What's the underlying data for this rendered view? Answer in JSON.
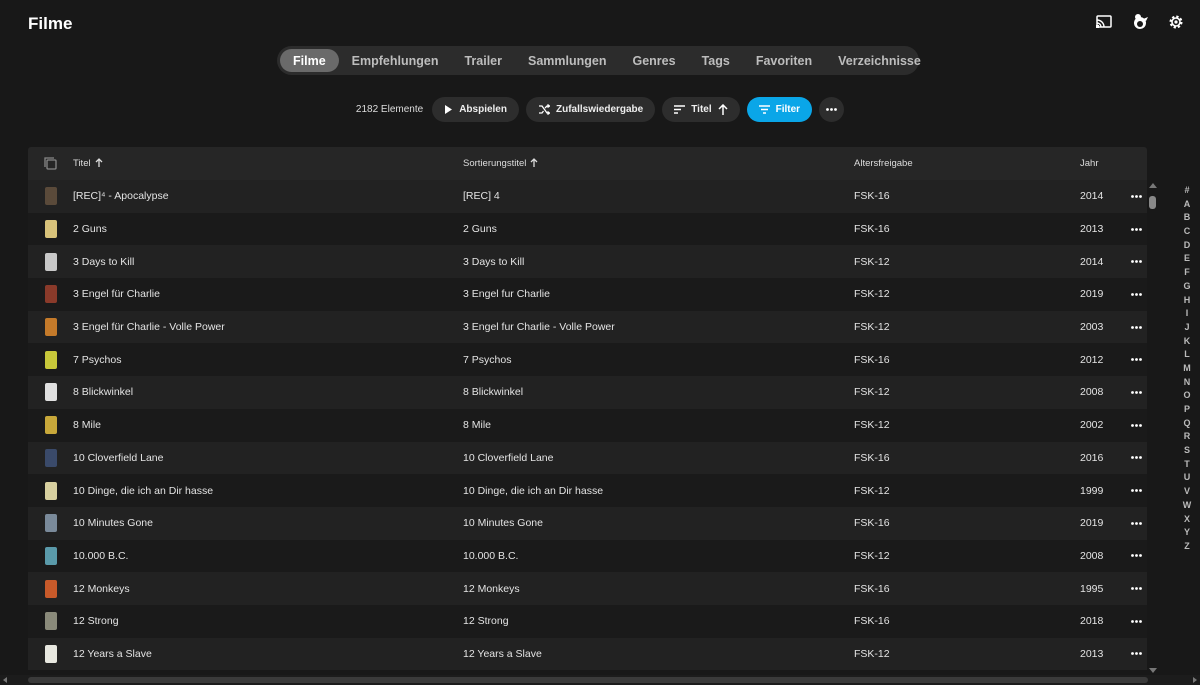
{
  "header": {
    "title": "Filme",
    "icons": [
      "cast-icon",
      "user-avatar-icon",
      "settings-icon"
    ]
  },
  "tabs": [
    {
      "label": "Filme",
      "active": true
    },
    {
      "label": "Empfehlungen"
    },
    {
      "label": "Trailer"
    },
    {
      "label": "Sammlungen"
    },
    {
      "label": "Genres"
    },
    {
      "label": "Tags"
    },
    {
      "label": "Favoriten"
    },
    {
      "label": "Verzeichnisse"
    }
  ],
  "toolbar": {
    "count": "2182 Elemente",
    "play": "Abspielen",
    "shuffle": "Zufallswiedergabe",
    "sort": "Titel",
    "filter": "Filter"
  },
  "columns": {
    "title": "Titel",
    "sort_title": "Sortierungstitel",
    "age": "Altersfreigabe",
    "year": "Jahr"
  },
  "rows": [
    {
      "title": "[REC]⁴ - Apocalypse",
      "sort_title": "[REC] 4",
      "age": "FSK-16",
      "year": "2014",
      "poster": "#5a4a3a"
    },
    {
      "title": "2 Guns",
      "sort_title": "2 Guns",
      "age": "FSK-16",
      "year": "2013",
      "poster": "#d8c27a"
    },
    {
      "title": "3 Days to Kill",
      "sort_title": "3 Days to Kill",
      "age": "FSK-12",
      "year": "2014",
      "poster": "#c8c8c8"
    },
    {
      "title": "3 Engel für Charlie",
      "sort_title": "3 Engel fur Charlie",
      "age": "FSK-12",
      "year": "2019",
      "poster": "#8a3a2a"
    },
    {
      "title": "3 Engel für Charlie - Volle Power",
      "sort_title": "3 Engel fur Charlie - Volle Power",
      "age": "FSK-12",
      "year": "2003",
      "poster": "#c47a2a"
    },
    {
      "title": "7 Psychos",
      "sort_title": "7 Psychos",
      "age": "FSK-16",
      "year": "2012",
      "poster": "#c8c83a"
    },
    {
      "title": "8 Blickwinkel",
      "sort_title": "8 Blickwinkel",
      "age": "FSK-12",
      "year": "2008",
      "poster": "#e0e0e0"
    },
    {
      "title": "8 Mile",
      "sort_title": "8 Mile",
      "age": "FSK-12",
      "year": "2002",
      "poster": "#c8a83a"
    },
    {
      "title": "10 Cloverfield Lane",
      "sort_title": "10 Cloverfield Lane",
      "age": "FSK-16",
      "year": "2016",
      "poster": "#3a4a6a"
    },
    {
      "title": "10 Dinge, die ich an Dir hasse",
      "sort_title": "10 Dinge, die ich an Dir hasse",
      "age": "FSK-12",
      "year": "1999",
      "poster": "#d8d0a0"
    },
    {
      "title": "10 Minutes Gone",
      "sort_title": "10 Minutes Gone",
      "age": "FSK-16",
      "year": "2019",
      "poster": "#7a8a9a"
    },
    {
      "title": "10.000 B.C.",
      "sort_title": "10.000 B.C.",
      "age": "FSK-12",
      "year": "2008",
      "poster": "#5a9aaa"
    },
    {
      "title": "12 Monkeys",
      "sort_title": "12 Monkeys",
      "age": "FSK-16",
      "year": "1995",
      "poster": "#c85a2a"
    },
    {
      "title": "12 Strong",
      "sort_title": "12 Strong",
      "age": "FSK-16",
      "year": "2018",
      "poster": "#8a8a7a"
    },
    {
      "title": "12 Years a Slave",
      "sort_title": "12 Years a Slave",
      "age": "FSK-12",
      "year": "2013",
      "poster": "#e8e8e0"
    }
  ],
  "alphabet": [
    "#",
    "A",
    "B",
    "C",
    "D",
    "E",
    "F",
    "G",
    "H",
    "I",
    "J",
    "K",
    "L",
    "M",
    "N",
    "O",
    "P",
    "Q",
    "R",
    "S",
    "T",
    "U",
    "V",
    "W",
    "X",
    "Y",
    "Z"
  ]
}
